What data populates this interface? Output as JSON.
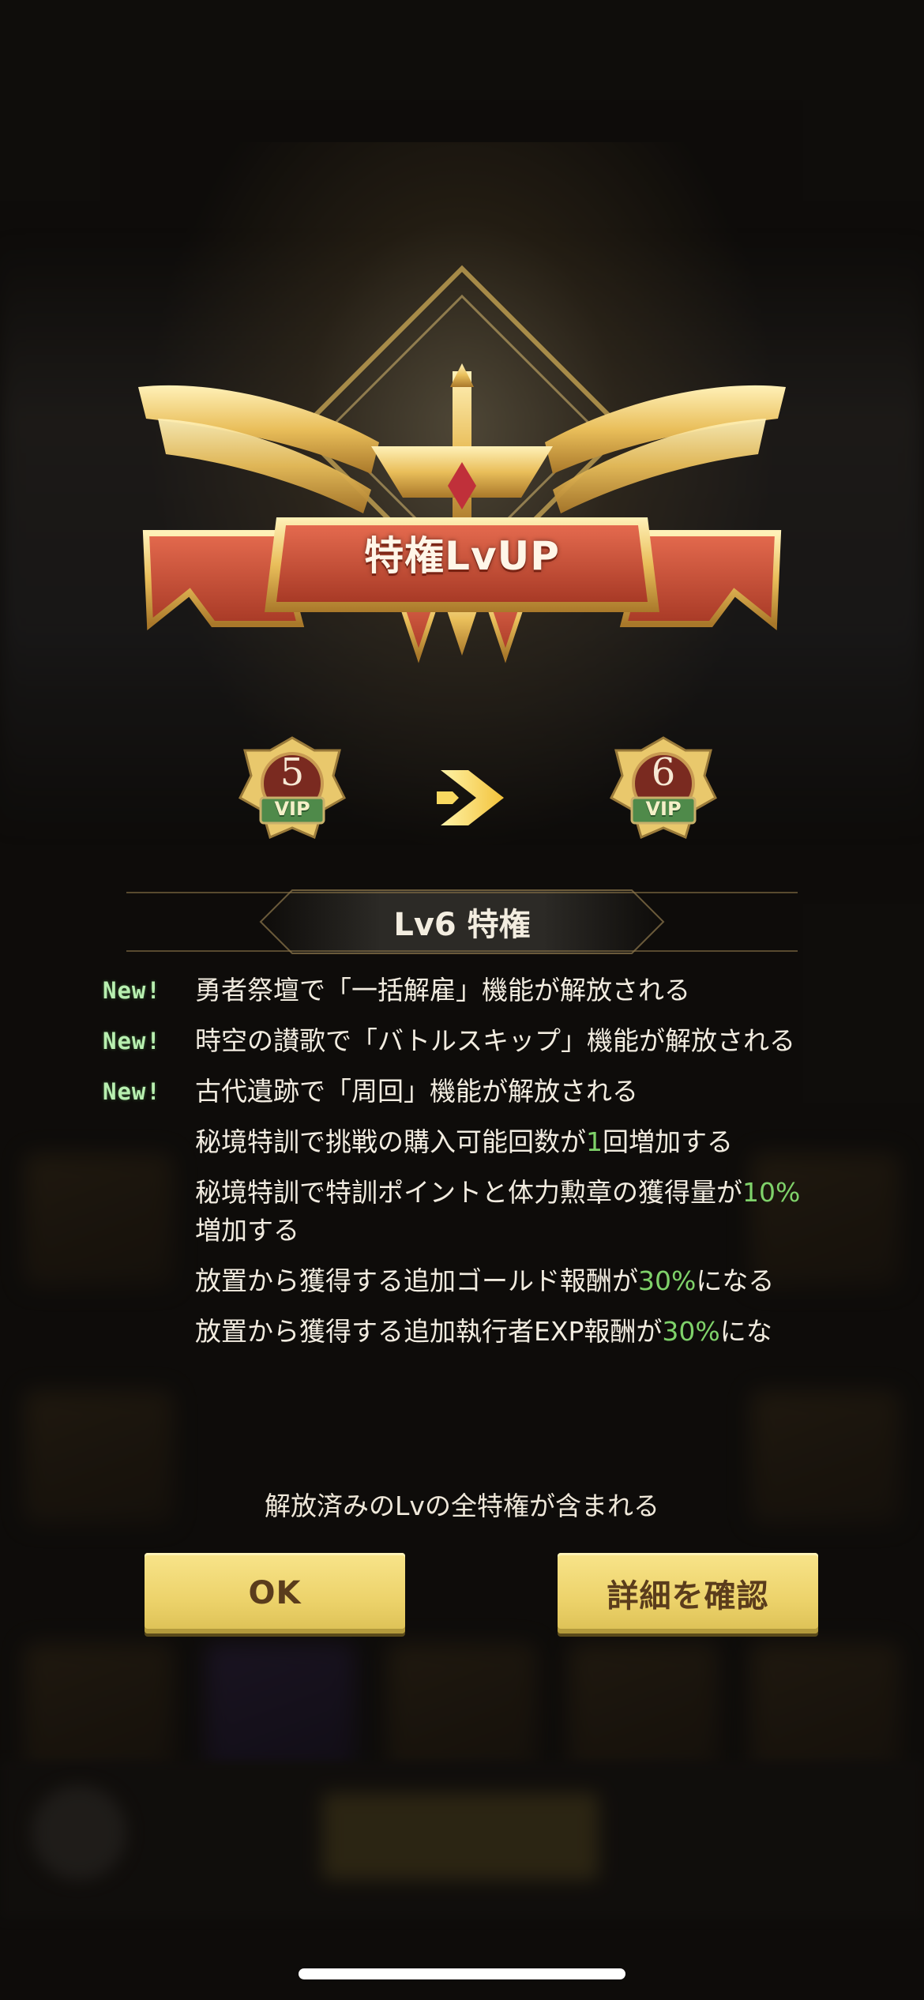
{
  "emblem": {
    "title": "特権LvUP"
  },
  "vip": {
    "from_level": "5",
    "to_level": "6",
    "tag": "VIP"
  },
  "section": {
    "title": "Lv6 特権"
  },
  "new_label": "New!",
  "perks": [
    {
      "is_new": true,
      "parts": [
        "勇者祭壇で「一括解雇」機能が解放される"
      ]
    },
    {
      "is_new": true,
      "parts": [
        "時空の讃歌で「バトルスキップ」機能が解放される"
      ]
    },
    {
      "is_new": true,
      "parts": [
        "古代遺跡で「周回」機能が解放される"
      ]
    },
    {
      "is_new": false,
      "parts": [
        "秘境特訓で挑戦の購入可能回数が",
        "1",
        "回増加する"
      ]
    },
    {
      "is_new": false,
      "parts": [
        "秘境特訓で特訓ポイントと体力勲章の獲得量が",
        "10%",
        "増加する"
      ]
    },
    {
      "is_new": false,
      "parts": [
        "放置から獲得する追加ゴールド報酬が",
        "30%",
        "になる"
      ]
    },
    {
      "is_new": false,
      "parts": [
        "放置から獲得する追加執行者EXP報酬が",
        "30%",
        "にな"
      ]
    }
  ],
  "note": "解放済みのLvの全特権が含まれる",
  "buttons": {
    "ok": "OK",
    "detail": "詳細を確認"
  },
  "colors": {
    "highlight": "#7fd26a",
    "button": "#ecd26a",
    "ribbon": "#c8503a",
    "gold": "#e8c060"
  }
}
